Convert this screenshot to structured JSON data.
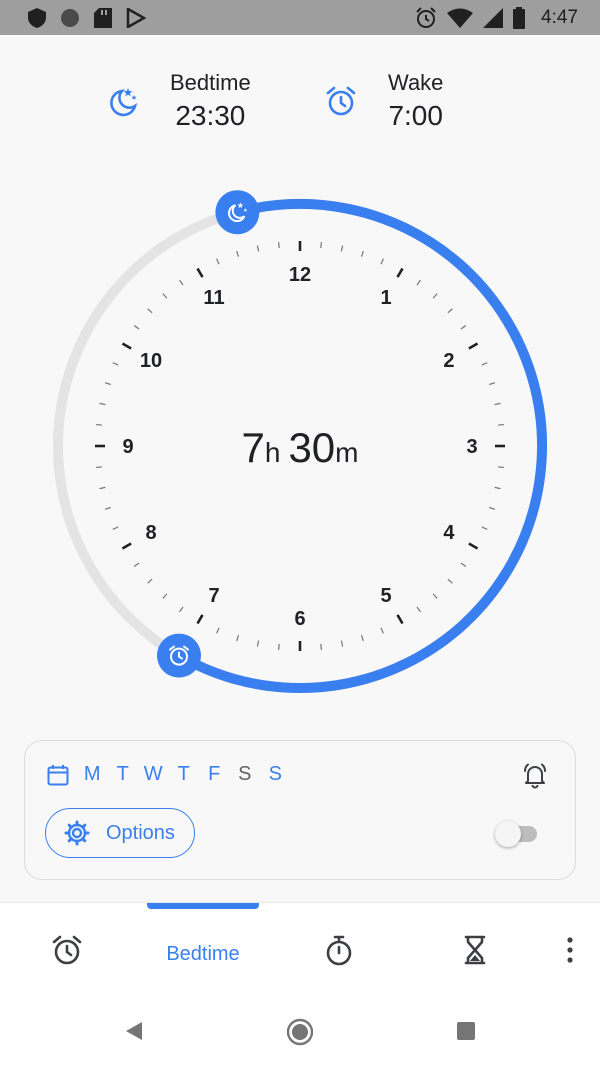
{
  "status_bar": {
    "time": "4:47",
    "left_icons": [
      "shield-icon",
      "circle-icon",
      "sd-card-icon",
      "play-store-icon"
    ],
    "right_icons": [
      "alarm-icon",
      "wifi-icon",
      "signal-icon",
      "battery-icon"
    ]
  },
  "schedule": {
    "bedtime": {
      "label": "Bedtime",
      "value": "23:30",
      "icon": "moon-stars-icon"
    },
    "wake": {
      "label": "Wake",
      "value": "7:00",
      "icon": "alarm-clock-icon"
    }
  },
  "dial": {
    "hour_numbers": [
      "12",
      "1",
      "2",
      "3",
      "4",
      "5",
      "6",
      "7",
      "8",
      "9",
      "10",
      "11"
    ],
    "duration": {
      "hours": "7",
      "hours_unit": "h",
      "minutes": "30",
      "minutes_unit": "m"
    },
    "bedtime_hours": 23.5,
    "wake_hours": 7.0
  },
  "days": {
    "items": [
      {
        "label": "M",
        "active": true
      },
      {
        "label": "T",
        "active": true
      },
      {
        "label": "W",
        "active": true
      },
      {
        "label": "T",
        "active": true
      },
      {
        "label": "F",
        "active": true
      },
      {
        "label": "S",
        "active": false
      },
      {
        "label": "S",
        "active": true
      }
    ]
  },
  "options": {
    "label": "Options",
    "toggle_on": false
  },
  "bottom_nav": {
    "items": [
      "alarm-icon",
      "Bedtime",
      "stopwatch-icon",
      "timer-icon",
      "more-icon"
    ],
    "active_label": "Bedtime"
  },
  "colors": {
    "accent": "#3a7ff0",
    "track": "#e4e4e4",
    "text": "#202124"
  }
}
